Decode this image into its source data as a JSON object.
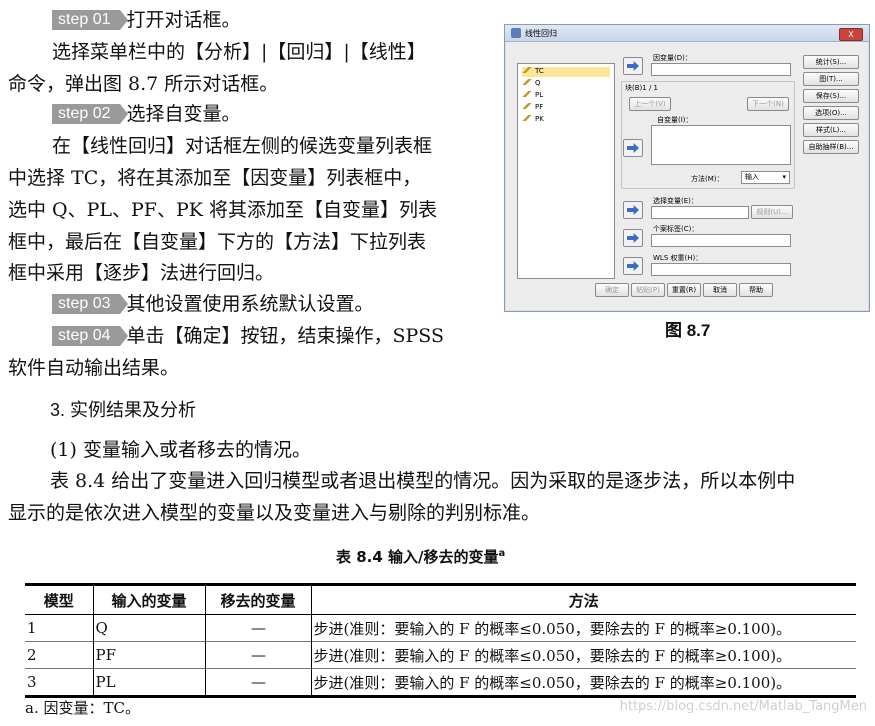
{
  "steps": [
    {
      "badge": "step 01",
      "text": "打开对话框。"
    },
    {
      "badge": "step 02",
      "text": "选择自变量。"
    },
    {
      "badge": "step 03",
      "text": "其他设置使用系统默认设置。"
    },
    {
      "badge": "step 04",
      "text": "单击【确定】按钮，结束操作，SPSS"
    }
  ],
  "step1_body": [
    "选择菜单栏中的【分析】|【回归】|【线性】",
    "命令，弹出图 8.7 所示对话框。"
  ],
  "step2_body": [
    "在【线性回归】对话框左侧的候选变量列表框",
    "中选择 TC，将在其添加至【因变量】列表框中，",
    "选中 Q、PL、PF、PK 将其添加至【自变量】列表",
    "框中，最后在【自变量】下方的【方法】下拉列表",
    "框中采用【逐步】法进行回归。"
  ],
  "step4_cont": "软件自动输出结果。",
  "figure": {
    "caption": "图 8.7",
    "dialog": {
      "title": "线性回归",
      "close": "X",
      "variables": [
        "TC",
        "Q",
        "PL",
        "PF",
        "PK"
      ],
      "selected_variable": "TC",
      "dependent_label": "因变量(D)：",
      "block_label": "块(B)1 / 1",
      "prev_button": "上一个(V)",
      "next_button": "下一个(N)",
      "independent_label": "自变量(I)：",
      "method_label": "方法(M)：",
      "method_value": "输入",
      "selection_label": "选择变量(E)：",
      "rule_button": "规则(U)...",
      "case_label": "个案标签(C)：",
      "wls_label": "WLS 权重(H)：",
      "side_buttons": [
        "统计(S)...",
        "图(T)...",
        "保存(S)...",
        "选项(O)...",
        "样式(L)...",
        "自助抽样(B)..."
      ],
      "bottom_buttons": [
        "确定",
        "粘贴(P)",
        "重置(R)",
        "取消",
        "帮助"
      ]
    }
  },
  "section_heading": "3. 实例结果及分析",
  "subsection": "(1)  变量输入或者移去的情况。",
  "para": [
    "表 8.4 给出了变量进入回归模型或者退出模型的情况。因为采取的是逐步法，所以本例中",
    "显示的是依次进入模型的变量以及变量进入与剔除的判别标准。"
  ],
  "table": {
    "caption": "表 8.4    输入/移去的变量",
    "caption_sup": "a",
    "headers": [
      "模型",
      "输入的变量",
      "移去的变量",
      "方法"
    ],
    "rows": [
      [
        "1",
        "Q",
        "—",
        "步进(准则：要输入的 F 的概率≤0.050，要除去的 F 的概率≥0.100)。"
      ],
      [
        "2",
        "PF",
        "—",
        "步进(准则：要输入的 F 的概率≤0.050，要除去的 F 的概率≥0.100)。"
      ],
      [
        "3",
        "PL",
        "—",
        "步进(准则：要输入的 F 的概率≤0.050，要除去的 F 的概率≥0.100)。"
      ]
    ],
    "note": "a. 因变量：TC。"
  },
  "watermark": "https://blog.csdn.net/Matlab_TangMen"
}
